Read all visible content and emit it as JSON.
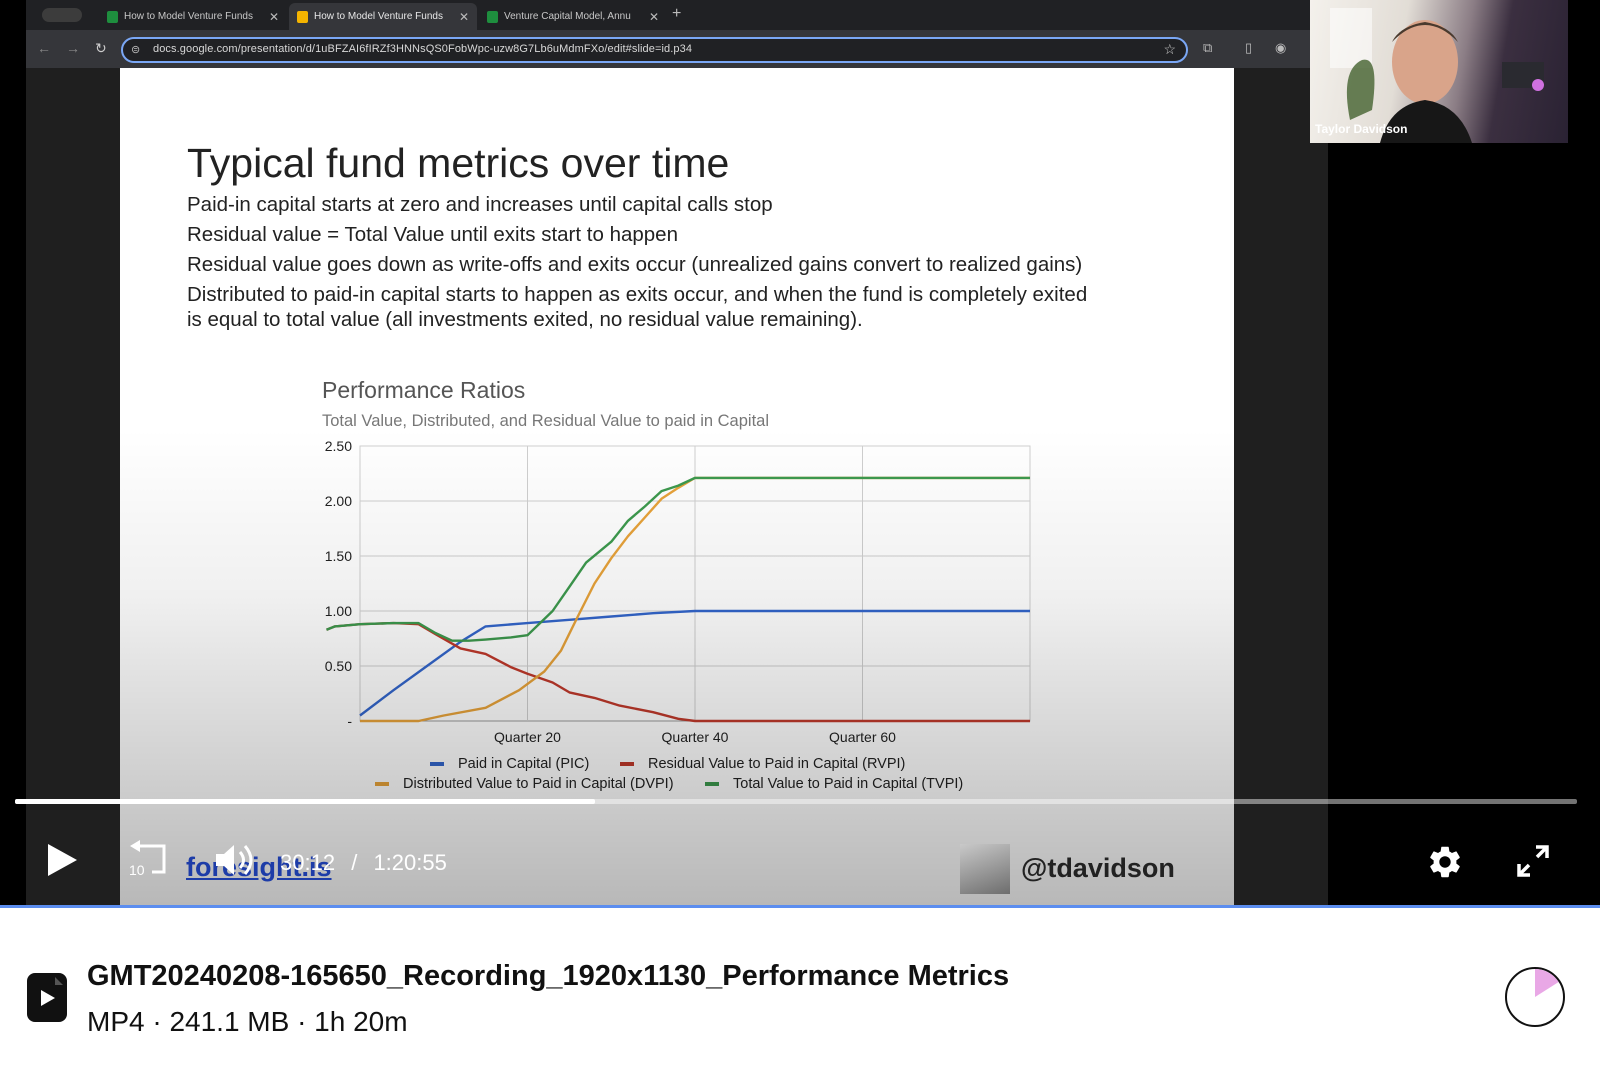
{
  "browser": {
    "tabs": [
      {
        "label": "How to Model Venture Funds",
        "icon": "sheets-icon",
        "color": "#1e8e3e"
      },
      {
        "label": "How to Model Venture Funds",
        "icon": "slides-icon",
        "color": "#f4b400"
      },
      {
        "label": "Venture Capital Model, Annu",
        "icon": "sheets-icon",
        "color": "#1e8e3e"
      }
    ],
    "new_tab": "+",
    "url": "docs.google.com/presentation/d/1uBFZAI6fIRZf3HNNsQS0FobWpc-uzw8G7Lb6uMdmFXo/edit#slide=id.p34"
  },
  "slide": {
    "title": "Typical fund metrics over time",
    "bullets": [
      "Paid-in capital starts at zero and increases until capital calls stop",
      "Residual value = Total Value until exits start to happen",
      "Residual value goes down as write-offs and exits occur (unrealized gains convert to realized gains)",
      "Distributed to paid-in capital starts to happen as exits occur, and when the fund is completely exited",
      "is equal to total value (all investments exited, no residual value remaining)."
    ],
    "footer_link": "foresight.is",
    "handle": "@tdavidson"
  },
  "chart_data": {
    "type": "line",
    "title": "Performance Ratios",
    "subtitle": "Total Value, Distributed, and Residual Value to paid in Capital",
    "x_tick_labels": [
      {
        "x": 20,
        "label": "Quarter 20"
      },
      {
        "x": 40,
        "label": "Quarter 40"
      },
      {
        "x": 60,
        "label": "Quarter 60"
      }
    ],
    "y_tick_labels": [
      "-",
      "0.50",
      "1.00",
      "1.50",
      "2.00",
      "2.50"
    ],
    "y_tick_values": [
      0,
      0.5,
      1.0,
      1.5,
      2.0,
      2.5
    ],
    "xlim": [
      0,
      80
    ],
    "ylim": [
      0,
      2.5
    ],
    "grid": true,
    "legend_position": "bottom",
    "series": [
      {
        "name": "Paid in Capital (PIC)",
        "color": "#3366cc",
        "points": [
          [
            0,
            0.05
          ],
          [
            4,
            0.28
          ],
          [
            8,
            0.5
          ],
          [
            12,
            0.72
          ],
          [
            15,
            0.86
          ],
          [
            20,
            0.89
          ],
          [
            25,
            0.92
          ],
          [
            30,
            0.95
          ],
          [
            35,
            0.98
          ],
          [
            40,
            1.0
          ],
          [
            50,
            1.0
          ],
          [
            60,
            1.0
          ],
          [
            70,
            1.0
          ],
          [
            80,
            1.0
          ]
        ]
      },
      {
        "name": "Residual Value to Paid in Capital (RVPI)",
        "color": "#c0392b",
        "points": [
          [
            -4,
            0.83
          ],
          [
            -3,
            0.86
          ],
          [
            0,
            0.88
          ],
          [
            4,
            0.89
          ],
          [
            7,
            0.88
          ],
          [
            9,
            0.79
          ],
          [
            12,
            0.66
          ],
          [
            15,
            0.61
          ],
          [
            18,
            0.49
          ],
          [
            20,
            0.43
          ],
          [
            23,
            0.35
          ],
          [
            25,
            0.26
          ],
          [
            28,
            0.21
          ],
          [
            31,
            0.14
          ],
          [
            35,
            0.08
          ],
          [
            38,
            0.02
          ],
          [
            40,
            0.0
          ],
          [
            50,
            0.0
          ],
          [
            60,
            0.0
          ],
          [
            70,
            0.0
          ],
          [
            80,
            0.0
          ]
        ]
      },
      {
        "name": "Distributed Value to Paid in Capital (DVPI)",
        "color": "#e8a33a",
        "points": [
          [
            0,
            0.0
          ],
          [
            4,
            0.0
          ],
          [
            7,
            0.0
          ],
          [
            10,
            0.05
          ],
          [
            15,
            0.12
          ],
          [
            19,
            0.28
          ],
          [
            22,
            0.45
          ],
          [
            24,
            0.64
          ],
          [
            26,
            0.95
          ],
          [
            28,
            1.25
          ],
          [
            30,
            1.48
          ],
          [
            32,
            1.68
          ],
          [
            34,
            1.85
          ],
          [
            36,
            2.02
          ],
          [
            38,
            2.12
          ],
          [
            40,
            2.21
          ],
          [
            50,
            2.21
          ],
          [
            60,
            2.21
          ],
          [
            70,
            2.21
          ],
          [
            80,
            2.21
          ]
        ]
      },
      {
        "name": "Total Value to Paid in Capital (TVPI)",
        "color": "#3d9a4e",
        "points": [
          [
            -4,
            0.83
          ],
          [
            -3,
            0.86
          ],
          [
            0,
            0.88
          ],
          [
            4,
            0.89
          ],
          [
            7,
            0.89
          ],
          [
            9,
            0.8
          ],
          [
            11,
            0.73
          ],
          [
            13,
            0.73
          ],
          [
            15,
            0.74
          ],
          [
            18,
            0.76
          ],
          [
            20,
            0.78
          ],
          [
            23,
            1.0
          ],
          [
            25,
            1.22
          ],
          [
            27,
            1.44
          ],
          [
            30,
            1.63
          ],
          [
            32,
            1.82
          ],
          [
            34,
            1.95
          ],
          [
            36,
            2.09
          ],
          [
            38,
            2.14
          ],
          [
            40,
            2.21
          ],
          [
            50,
            2.21
          ],
          [
            60,
            2.21
          ],
          [
            70,
            2.21
          ],
          [
            80,
            2.21
          ]
        ]
      }
    ]
  },
  "webcam": {
    "name": "Taylor Davidson"
  },
  "player": {
    "progress": 0.3714,
    "current_time": "30:12",
    "separator": "/",
    "duration": "1:20:55",
    "skip_back_seconds": "10"
  },
  "file": {
    "title": "GMT20240208-165650_Recording_1920x1130_Performance Metrics",
    "meta": "MP4 · 241.1 MB · 1h 20m",
    "download_progress": 0.16
  }
}
